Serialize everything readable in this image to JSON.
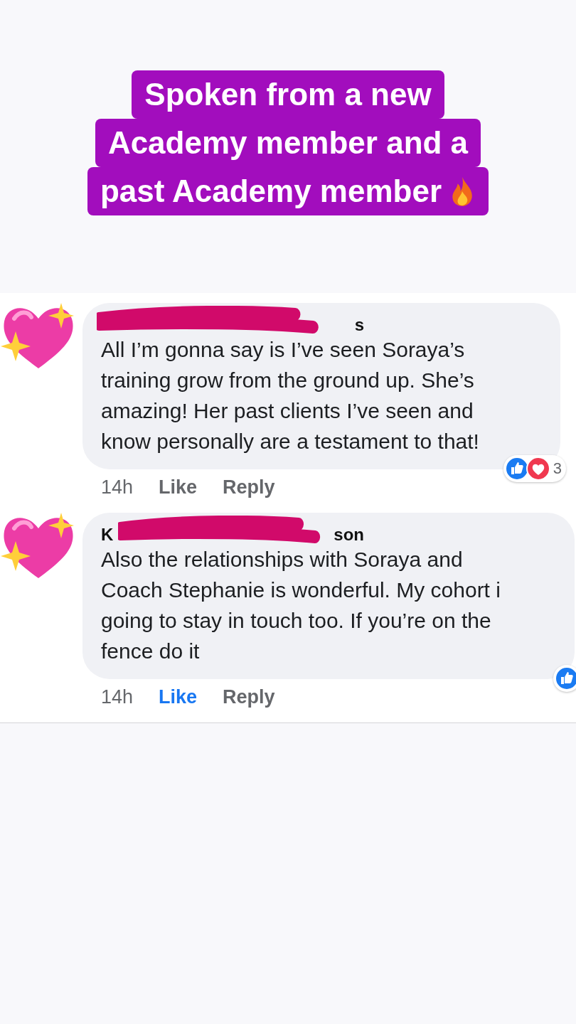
{
  "headline": {
    "lines": [
      "Spoken from a new",
      "Academy member and a",
      "past Academy member"
    ]
  },
  "comments": [
    {
      "name_end": "s",
      "body": "All I’m gonna say is I’ve seen Soraya’s\ntraining grow from the ground up. She’s\namazing! Her past clients I’ve seen and\nknow personally are a testament to that!",
      "time": "14h",
      "like": "Like",
      "reply": "Reply",
      "liked": false,
      "reactions": [
        {
          "kind": "like"
        },
        {
          "kind": "love"
        }
      ],
      "reaction_count": "3"
    },
    {
      "name_start": "K",
      "name_end": "son",
      "body": "Also the relationships with Soraya and\nCoach Stephanie is wonderful. My cohort i\ngoing to stay in touch too. If you’re on the\nfence do it",
      "time": "14h",
      "like": "Like",
      "reply": "Reply",
      "liked": true,
      "reactions": [
        {
          "kind": "like"
        }
      ]
    }
  ]
}
